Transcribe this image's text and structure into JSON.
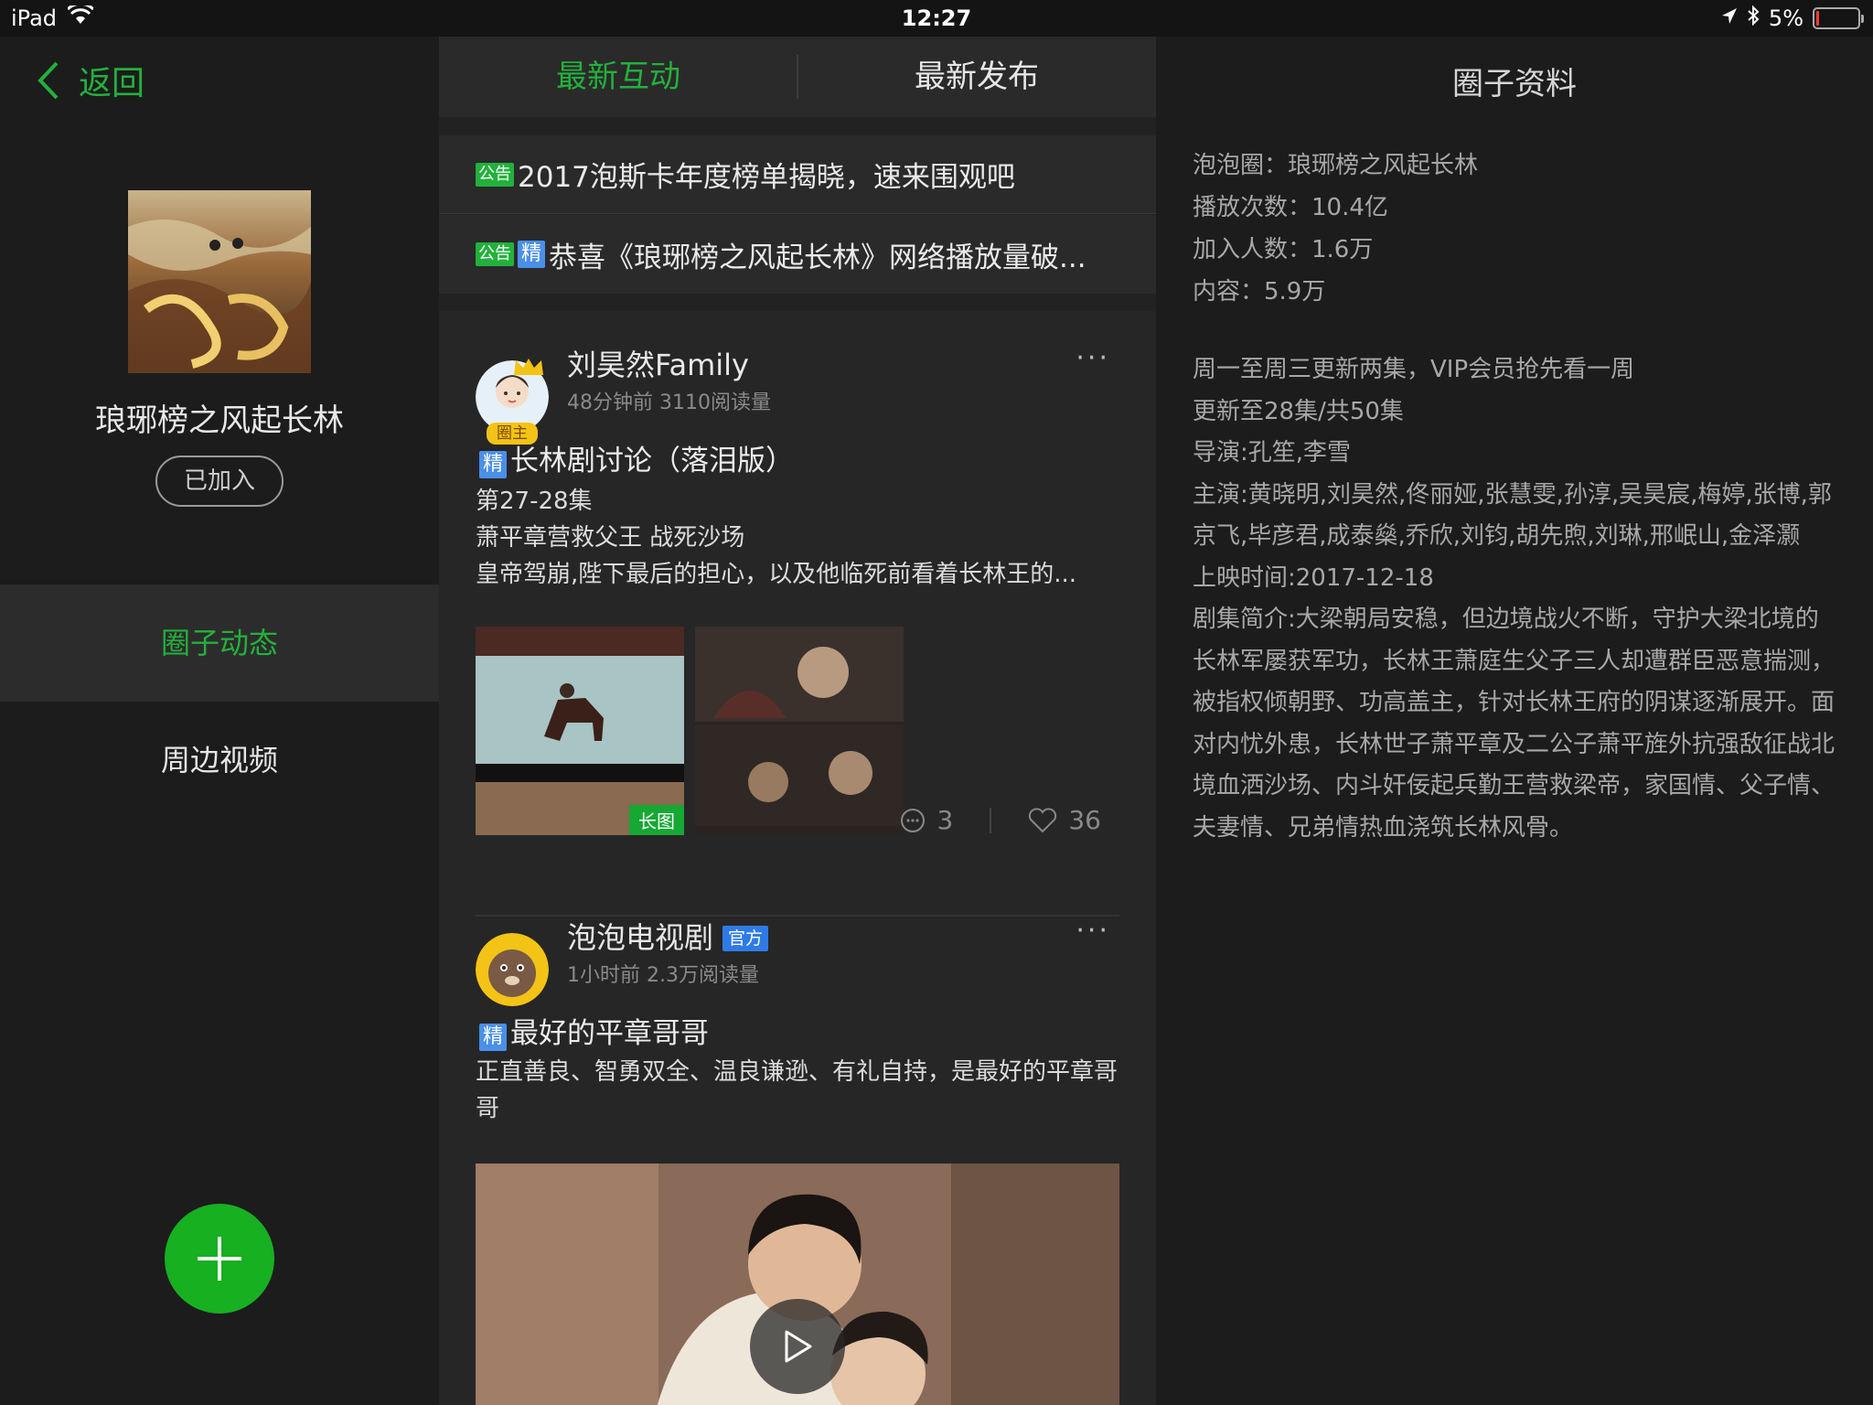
{
  "status_bar": {
    "device": "iPad",
    "time": "12:27",
    "battery": "5%"
  },
  "sidebar": {
    "back_label": "返回",
    "circle_name": "琅琊榜之风起长林",
    "joined_label": "已加入",
    "nav": [
      "圈子动态",
      "周边视频"
    ]
  },
  "tabs": {
    "latest_interaction": "最新互动",
    "latest_release": "最新发布"
  },
  "announcements": [
    {
      "tags": [
        "公告"
      ],
      "text": "2017泡斯卡年度榜单揭晓，速来围观吧"
    },
    {
      "tags": [
        "公告",
        "精"
      ],
      "text": "恭喜《琅琊榜之风起长林》网络播放量破..."
    }
  ],
  "posts": [
    {
      "author": "刘昊然Family",
      "badge": "圈主",
      "meta": "48分钟前 3110阅读量",
      "tag": "精",
      "title": "长林剧讨论（落泪版）",
      "body": [
        "第27-28集",
        "萧平章营救父王 战死沙场",
        "皇帝驾崩,陛下最后的担心，以及他临死前看着长林王的..."
      ],
      "long_image_label": "长图",
      "comments": "3",
      "likes": "36"
    },
    {
      "author": "泡泡电视剧",
      "official_label": "官方",
      "meta": "1小时前 2.3万阅读量",
      "tag": "精",
      "title": "最好的平章哥哥",
      "body": "正直善良、智勇双全、温良谦逊、有礼自持，是最好的平章哥哥"
    }
  ],
  "info_panel": {
    "title": "圈子资料",
    "stats": [
      "泡泡圈：琅琊榜之风起长林",
      "播放次数：10.4亿",
      "加入人数：1.6万",
      "内容：5.9万"
    ],
    "description": [
      "周一至周三更新两集，VIP会员抢先看一周",
      "更新至28集/共50集",
      "导演:孔笙,李雪",
      "主演:黄晓明,刘昊然,佟丽娅,张慧雯,孙淳,吴昊宸,梅婷,张博,郭京飞,毕彦君,成泰燊,乔欣,刘钧,胡先煦,刘琳,邢岷山,金泽灏",
      "上映时间:2017-12-18",
      "剧集简介:大梁朝局安稳，但边境战火不断，守护大梁北境的长林军屡获军功，长林王萧庭生父子三人却遭群臣恶意揣测，被指权倾朝野、功高盖主，针对长林王府的阴谋逐渐展开。面对内忧外患，长林世子萧平章及二公子萧平旌外抗强敌征战北境血洒沙场、内斗奸佞起兵勤王营救梁帝，家国情、父子情、夫妻情、兄弟情热血浇筑长林风骨。"
    ]
  },
  "colors": {
    "accent_green": "#22b13c",
    "background": "#141414",
    "tag_blue": "#4a8fe8"
  },
  "icons": [
    "wifi-icon",
    "location-icon",
    "bluetooth-icon",
    "battery-icon",
    "chevron-left-icon",
    "plus-icon",
    "more-icon",
    "comment-icon",
    "heart-icon",
    "play-icon"
  ]
}
